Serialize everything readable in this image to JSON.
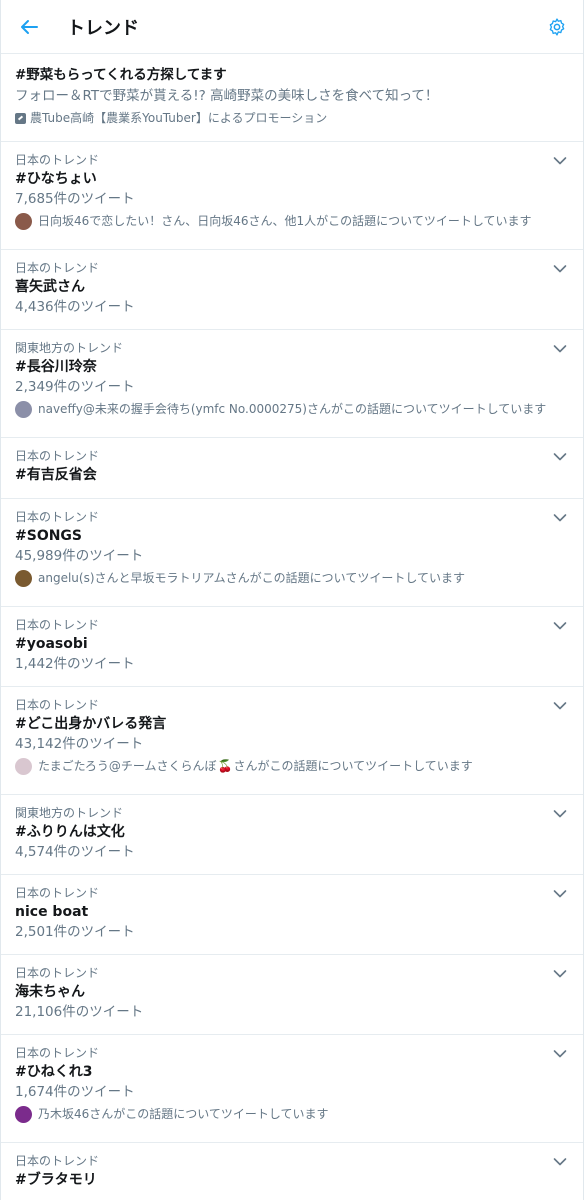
{
  "header": {
    "title": "トレンド",
    "accent_color": "#1da1f2",
    "back_icon": "arrow-left-icon",
    "settings_icon": "gear-icon"
  },
  "promo": {
    "title": "#野菜もらってくれる方探してます",
    "description": "フォロー＆RTで野菜が貰える!? 高崎野菜の美味しさを食べて知って！",
    "promoted_by": "農Tube高崎【農業系YouTuber】によるプロモーション"
  },
  "trends": [
    {
      "context": "日本のトレンド",
      "name": "#ひなちょい",
      "count": "7,685件のツイート",
      "desc": "日向坂46で恋したい！さん、日向坂46さん、他1人がこの話題についてツイートしています",
      "avatar": "#8a5a4a"
    },
    {
      "context": "日本のトレンド",
      "name": "喜矢武さん",
      "count": "4,436件のツイート"
    },
    {
      "context": "関東地方のトレンド",
      "name": "#長谷川玲奈",
      "count": "2,349件のツイート",
      "desc": "naveffy@未来の握手会待ち(ymfc No.0000275)さんがこの話題についてツイートしています",
      "avatar": "#8b8fa8"
    },
    {
      "context": "日本のトレンド",
      "name": "#有吉反省会"
    },
    {
      "context": "日本のトレンド",
      "name": "#SONGS",
      "count": "45,989件のツイート",
      "desc": "angelu(s)さんと早坂モラトリアムさんがこの話題についてツイートしています",
      "avatar": "#7a5a30"
    },
    {
      "context": "日本のトレンド",
      "name": "#yoasobi",
      "count": "1,442件のツイート"
    },
    {
      "context": "日本のトレンド",
      "name": "#どこ出身かバレる発言",
      "count": "43,142件のツイート",
      "desc_pre": "たまごたろう@チームさくらんぼ",
      "desc_emoji": "🍒",
      "desc_post": "さんがこの話題についてツイートしています",
      "avatar": "#d9c7d0"
    },
    {
      "context": "関東地方のトレンド",
      "name": "#ふりりんは文化",
      "count": "4,574件のツイート"
    },
    {
      "context": "日本のトレンド",
      "name": "nice boat",
      "count": "2,501件のツイート"
    },
    {
      "context": "日本のトレンド",
      "name": "海未ちゃん",
      "count": "21,106件のツイート"
    },
    {
      "context": "日本のトレンド",
      "name": "#ひねくれ3",
      "count": "1,674件のツイート",
      "desc": "乃木坂46さんがこの話題についてツイートしています",
      "avatar": "#7b2b8c"
    },
    {
      "context": "日本のトレンド",
      "name": "#ブラタモリ"
    }
  ]
}
